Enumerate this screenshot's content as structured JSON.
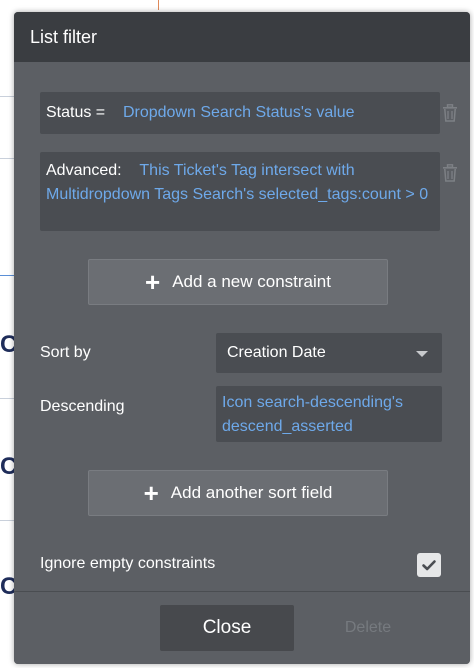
{
  "panel": {
    "title": "List filter"
  },
  "constraints": [
    {
      "label": "Status =",
      "value": "Dropdown Search Status's value"
    },
    {
      "label": "Advanced:",
      "value": "This Ticket's Tag intersect with Multidropdown Tags Search's selected_tags:count > 0"
    }
  ],
  "add_constraint_label": "Add a new constraint",
  "sort": {
    "label": "Sort by",
    "selected": "Creation Date"
  },
  "descending": {
    "label": "Descending",
    "value": "Icon search-descending's descend_asserted"
  },
  "add_sort_label": "Add another sort field",
  "ignore_empty": {
    "label": "Ignore empty constraints",
    "checked": true
  },
  "footer": {
    "close_label": "Close",
    "delete_label": "Delete"
  },
  "background": {
    "glyphs": [
      "Cu",
      "Cu",
      "Cu"
    ]
  },
  "icons": {
    "trash": "trash-icon",
    "plus": "plus-icon",
    "caret": "chevron-down-icon",
    "check": "check-icon"
  },
  "colors": {
    "panel_bg": "#5c5f64",
    "header_bg": "#3a3d41",
    "field_bg": "#4a4d52",
    "expression_text": "#6ea9ea",
    "button_bg": "#6b6e73"
  }
}
